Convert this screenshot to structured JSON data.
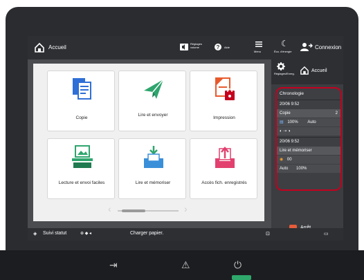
{
  "header": {
    "home_label": "Accueil",
    "volume_label": "Réglages volume",
    "help_label": "Aide",
    "menu_label": "Menu",
    "eco_label": "Éco. d'énergie",
    "login_label": "Connexion"
  },
  "sidepanel": {
    "settings_label": "Réglages/Enreg.",
    "home_label": "Accueil",
    "history": {
      "title": "Chronologie",
      "jobs": [
        {
          "time": "20/06 9:52",
          "name": "Copie",
          "count": "2",
          "scale": "100%",
          "mode": "Auto"
        },
        {
          "time": "20/06 9:52",
          "name": "Lire et mémoriser",
          "count": "00",
          "mode": "Auto",
          "scale": "100%"
        }
      ]
    },
    "stop_label": "Arrêt"
  },
  "tiles": [
    {
      "label": "Copie"
    },
    {
      "label": "Lire et envoyer"
    },
    {
      "label": "Impression"
    },
    {
      "label": "Lecture et envoi faciles"
    },
    {
      "label": "Lire et mémoriser"
    },
    {
      "label": "Accès fich. enregistrés"
    }
  ],
  "status": {
    "status_label": "Suivi statut",
    "message": "Charger papier."
  },
  "colors": {
    "accent_red": "#c4001e",
    "copy_blue": "#2f6fd6",
    "send_green": "#2fa56e",
    "print_orange": "#e85a2c",
    "store_blue": "#3a8fd9",
    "access_pink": "#e2406e"
  }
}
